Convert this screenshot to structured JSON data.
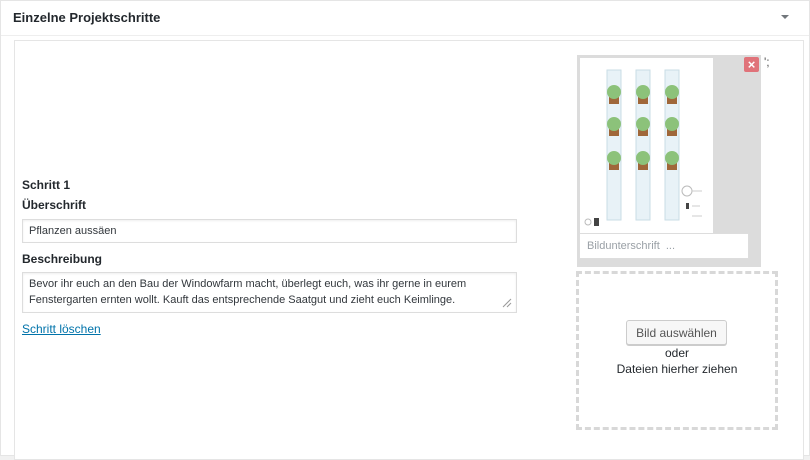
{
  "panel": {
    "title": "Einzelne Projektschritte"
  },
  "step": {
    "title": "Schritt 1",
    "heading_label": "Überschrift",
    "heading_value": "Pflanzen aussäen",
    "description_label": "Beschreibung",
    "description_value": "Bevor ihr euch an den Bau der Windowfarm macht, überlegt  euch, was ihr gerne in eurem Fenstergarten ernten wollt. Kauft das entsprechende Saatgut und zieht euch Keimlinge.",
    "delete_label": "Schritt löschen"
  },
  "image": {
    "remove_symbol": "×",
    "trailing_text": "';",
    "caption_placeholder": "Bildunterschrift  ..."
  },
  "upload": {
    "select_label": "Bild auswählen",
    "or_label": "oder",
    "drop_label": "Dateien hierher ziehen"
  },
  "colors": {
    "accent_link": "#0073aa",
    "remove_button": "#e0737a",
    "plant_green": "#8cc27a",
    "pot_brown": "#a0673a"
  }
}
